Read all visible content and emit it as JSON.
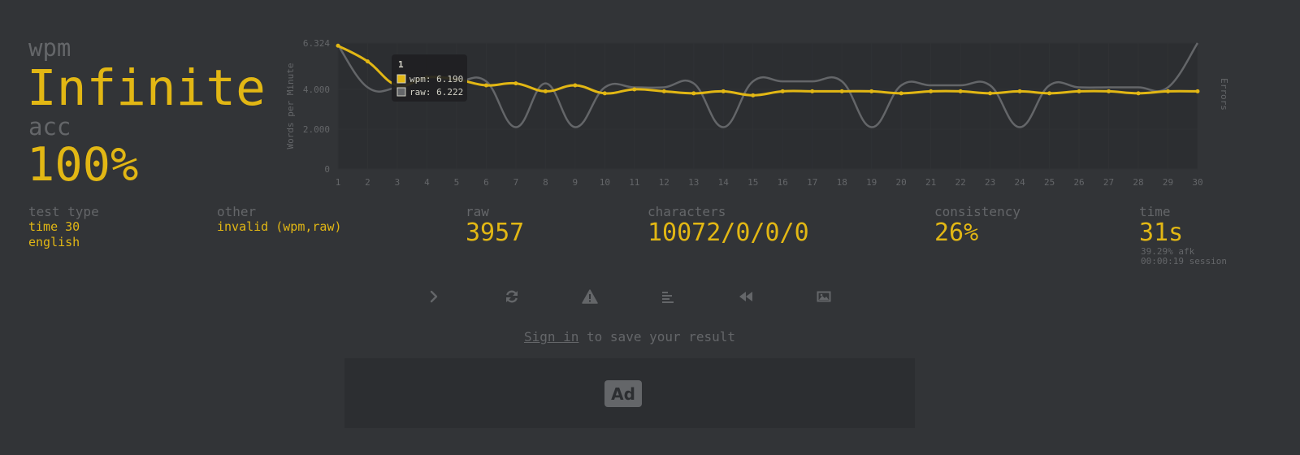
{
  "results": {
    "wpm_label": "wpm",
    "wpm_value": "Infinite",
    "acc_label": "acc",
    "acc_value": "100%"
  },
  "stats": {
    "test_type": {
      "label": "test type",
      "line1": "time 30",
      "line2": "english"
    },
    "other": {
      "label": "other",
      "value": "invalid (wpm,raw)"
    },
    "raw": {
      "label": "raw",
      "value": "3957"
    },
    "characters": {
      "label": "characters",
      "value": "10072/0/0/0"
    },
    "consistency": {
      "label": "consistency",
      "value": "26%"
    },
    "time": {
      "label": "time",
      "value": "31s",
      "afk": "39.29% afk",
      "session": "00:00:19 session"
    }
  },
  "buttons": [
    {
      "name": "next-test-button",
      "icon": "chevron-right-icon"
    },
    {
      "name": "repeat-test-button",
      "icon": "refresh-icon"
    },
    {
      "name": "report-button",
      "icon": "warning-icon"
    },
    {
      "name": "words-history-button",
      "icon": "align-left-icon"
    },
    {
      "name": "replay-button",
      "icon": "backward-icon"
    },
    {
      "name": "save-screenshot-button",
      "icon": "image-icon"
    }
  ],
  "signin": {
    "link": "Sign in",
    "rest": " to save your result"
  },
  "ad": {
    "label": "Ad"
  },
  "colors": {
    "background": "#323437",
    "main": "#e2b714",
    "sub": "#646669",
    "text": "#d1d0c5",
    "ad_bg": "#2c2e31"
  },
  "chart_data": {
    "type": "line",
    "ylabel": "Words per Minute",
    "y2label": "Errors",
    "ylim": [
      0,
      6.324
    ],
    "y_ticks": [
      "0",
      "2.000",
      "4.000",
      "6.324"
    ],
    "x": [
      1,
      2,
      3,
      4,
      5,
      6,
      7,
      8,
      9,
      10,
      11,
      12,
      13,
      14,
      15,
      16,
      17,
      18,
      19,
      20,
      21,
      22,
      23,
      24,
      25,
      26,
      27,
      28,
      29,
      30
    ],
    "series": [
      {
        "name": "raw",
        "color": "#646669",
        "values": [
          6.222,
          4.1,
          4.1,
          4.6,
          4.4,
          4.4,
          2.1,
          4.3,
          2.1,
          4.1,
          4.1,
          4.1,
          4.3,
          2.1,
          4.4,
          4.4,
          4.4,
          4.4,
          2.1,
          4.2,
          4.2,
          4.2,
          4.2,
          2.1,
          4.2,
          4.1,
          4.1,
          4.1,
          4.1,
          6.324
        ]
      },
      {
        "name": "wpm",
        "color": "#e2b714",
        "values": [
          6.19,
          5.4,
          4.2,
          4.6,
          4.5,
          4.2,
          4.3,
          3.9,
          4.2,
          3.8,
          4.0,
          3.9,
          3.8,
          3.9,
          3.7,
          3.9,
          3.9,
          3.9,
          3.9,
          3.8,
          3.9,
          3.9,
          3.8,
          3.9,
          3.8,
          3.9,
          3.9,
          3.8,
          3.9,
          3.9
        ]
      }
    ],
    "tooltip": {
      "title": "1",
      "wpm_text": "wpm: 6.190",
      "raw_text": "raw: 6.222"
    }
  }
}
